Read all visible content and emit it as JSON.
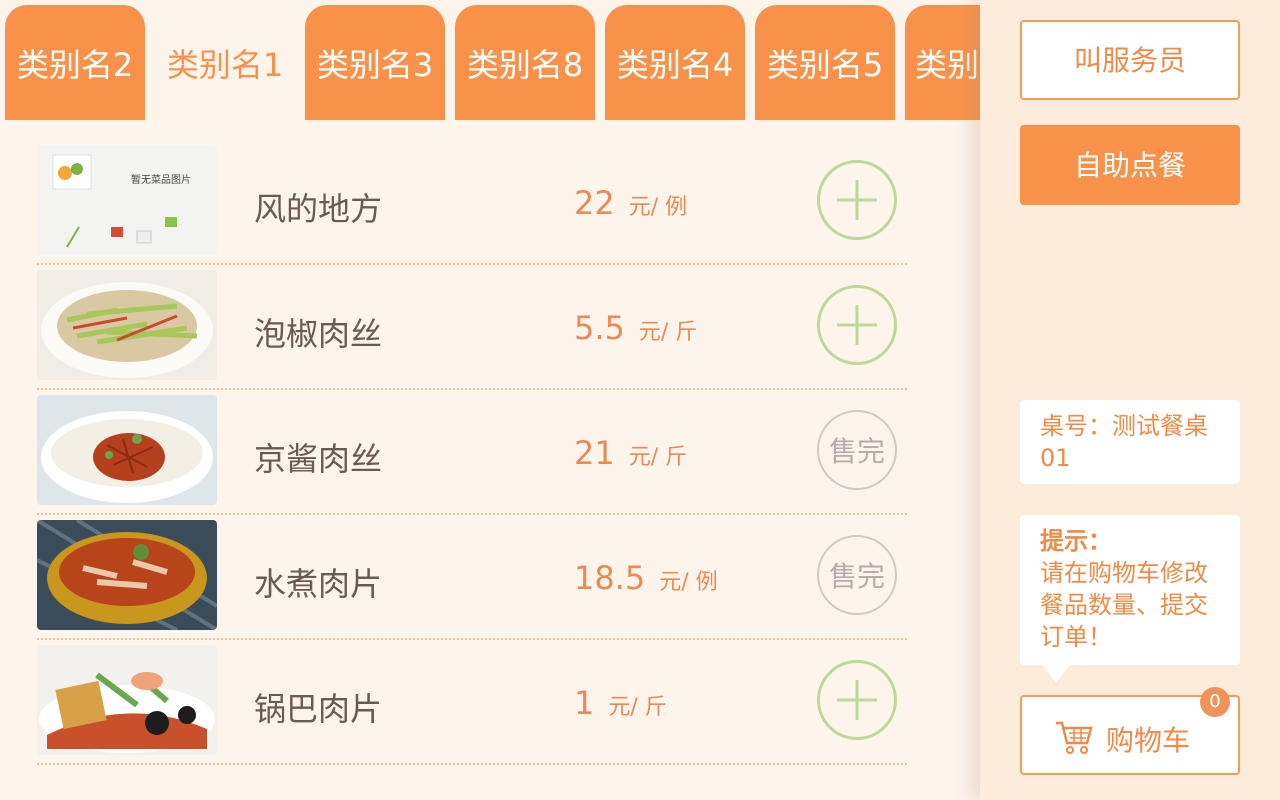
{
  "tabs": [
    {
      "label": "类别名2",
      "active": false
    },
    {
      "label": "类别名1",
      "active": true
    },
    {
      "label": "类别名3",
      "active": false
    },
    {
      "label": "类别名8",
      "active": false
    },
    {
      "label": "类别名4",
      "active": false
    },
    {
      "label": "类别名5",
      "active": false
    },
    {
      "label": "类别",
      "active": false
    }
  ],
  "dishes": [
    {
      "name": "风的地方",
      "price": "22",
      "unit": "元/ 例",
      "status": "add",
      "image_caption": "暂无菜品图片"
    },
    {
      "name": "泡椒肉丝",
      "price": "5.5",
      "unit": "元/ 斤",
      "status": "add"
    },
    {
      "name": "京酱肉丝",
      "price": "21",
      "unit": "元/ 斤",
      "status": "soldout",
      "soldout_label": "售完"
    },
    {
      "name": "水煮肉片",
      "price": "18.5",
      "unit": "元/ 例",
      "status": "soldout",
      "soldout_label": "售完"
    },
    {
      "name": "锅巴肉片",
      "price": "1",
      "unit": "元/ 斤",
      "status": "add"
    }
  ],
  "sidebar": {
    "call_waiter_label": "叫服务员",
    "self_order_label": "自助点餐",
    "table_info": "桌号：测试餐桌01",
    "tip_title": "提示：",
    "tip_text": "请在购物车修改餐品数量、提交订单！",
    "cart_label": "购物车",
    "cart_count": "0"
  },
  "colors": {
    "accent": "#f8924a",
    "page_bg": "#fdf4ec",
    "sidebar_bg": "#fdebdc",
    "add_ring": "#bcd89b",
    "soldout_ring": "#d4c6c4"
  },
  "icons": {
    "add": "plus-icon",
    "cart": "cart-icon"
  }
}
